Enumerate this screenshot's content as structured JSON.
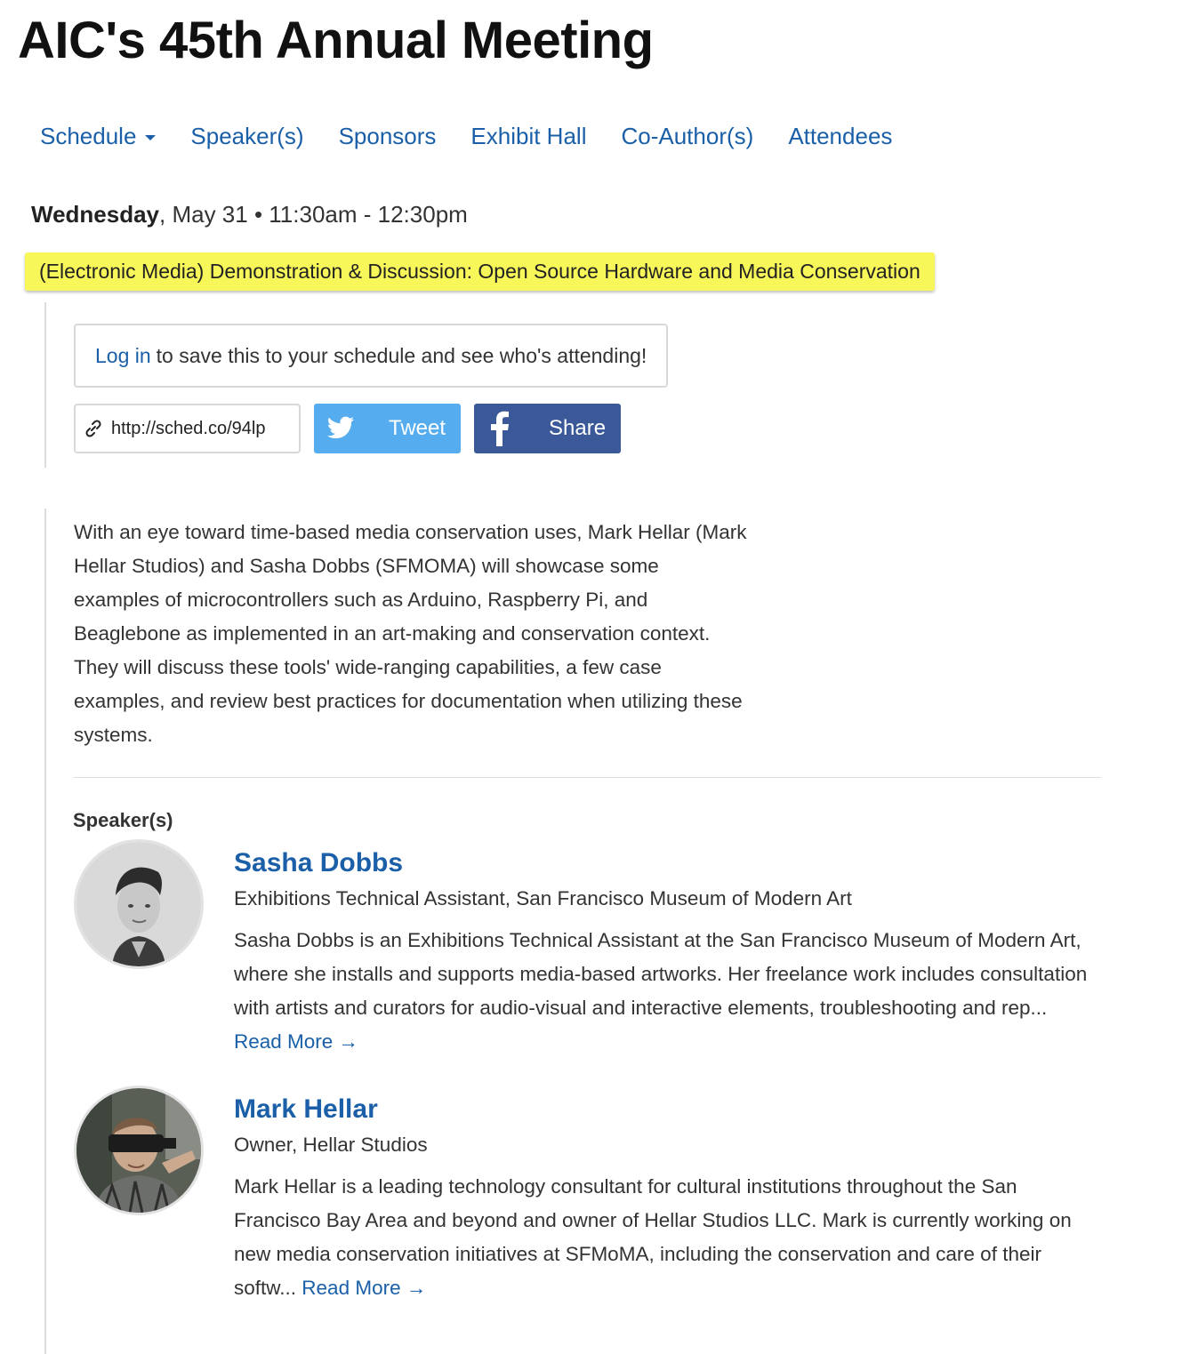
{
  "page": {
    "title": "AIC's 45th Annual Meeting"
  },
  "nav": {
    "items": [
      {
        "label": "Schedule",
        "has_dropdown": true
      },
      {
        "label": "Speaker(s)"
      },
      {
        "label": "Sponsors"
      },
      {
        "label": "Exhibit Hall"
      },
      {
        "label": "Co-Author(s)"
      },
      {
        "label": "Attendees"
      }
    ]
  },
  "session": {
    "day": "Wednesday",
    "date_time": ", May 31 • 11:30am - 12:30pm",
    "title": "(Electronic Media) Demonstration & Discussion: Open Source Hardware and Media Conservation",
    "highlight_color": "#f8f75a"
  },
  "login": {
    "link_label": "Log in",
    "text": "to save this to your schedule and see who's attending!"
  },
  "share": {
    "short_url": "http://sched.co/94lp",
    "link_icon": "link-icon",
    "tweet_label": "Tweet",
    "tweet_icon": "twitter-bird-icon",
    "tweet_color": "#55acee",
    "share_label": "Share",
    "share_icon": "facebook-f-icon",
    "share_color": "#3b5998"
  },
  "description": "With an eye toward time-based media conservation uses, Mark Hellar (Mark Hellar Studios) and Sasha Dobbs (SFMOMA)  will showcase some examples of microcontrollers such as Arduino, Raspberry Pi, and Beaglebone as implemented in an art-making and conservation context. They will discuss these tools' wide-ranging capabilities, a few case examples, and review best practices for documentation when utilizing these systems.",
  "speakers": {
    "heading": "Speaker(s)",
    "list": [
      {
        "name": "Sasha Dobbs",
        "role": "Exhibitions Technical Assistant, San Francisco Museum of Modern Art",
        "bio": "Sasha Dobbs is an Exhibitions Technical Assistant at the San Francisco Museum of Modern Art, where she installs and supports media-based artworks. Her freelance work includes consultation with artists and curators for audio-visual and interactive elements, troubleshooting and rep...",
        "read_more": "Read More →"
      },
      {
        "name": "Mark Hellar",
        "role": "Owner, Hellar Studios",
        "bio": "Mark Hellar is a leading technology consultant for cultural institutions throughout the San Francisco Bay Area and beyond and owner of Hellar Studios LLC. Mark is currently working on new media conservation initiatives at SFMoMA, including the conservation and care of their softw...",
        "read_more": "Read More →"
      }
    ]
  },
  "colors": {
    "link": "#1a5fa8",
    "text": "#333333"
  }
}
